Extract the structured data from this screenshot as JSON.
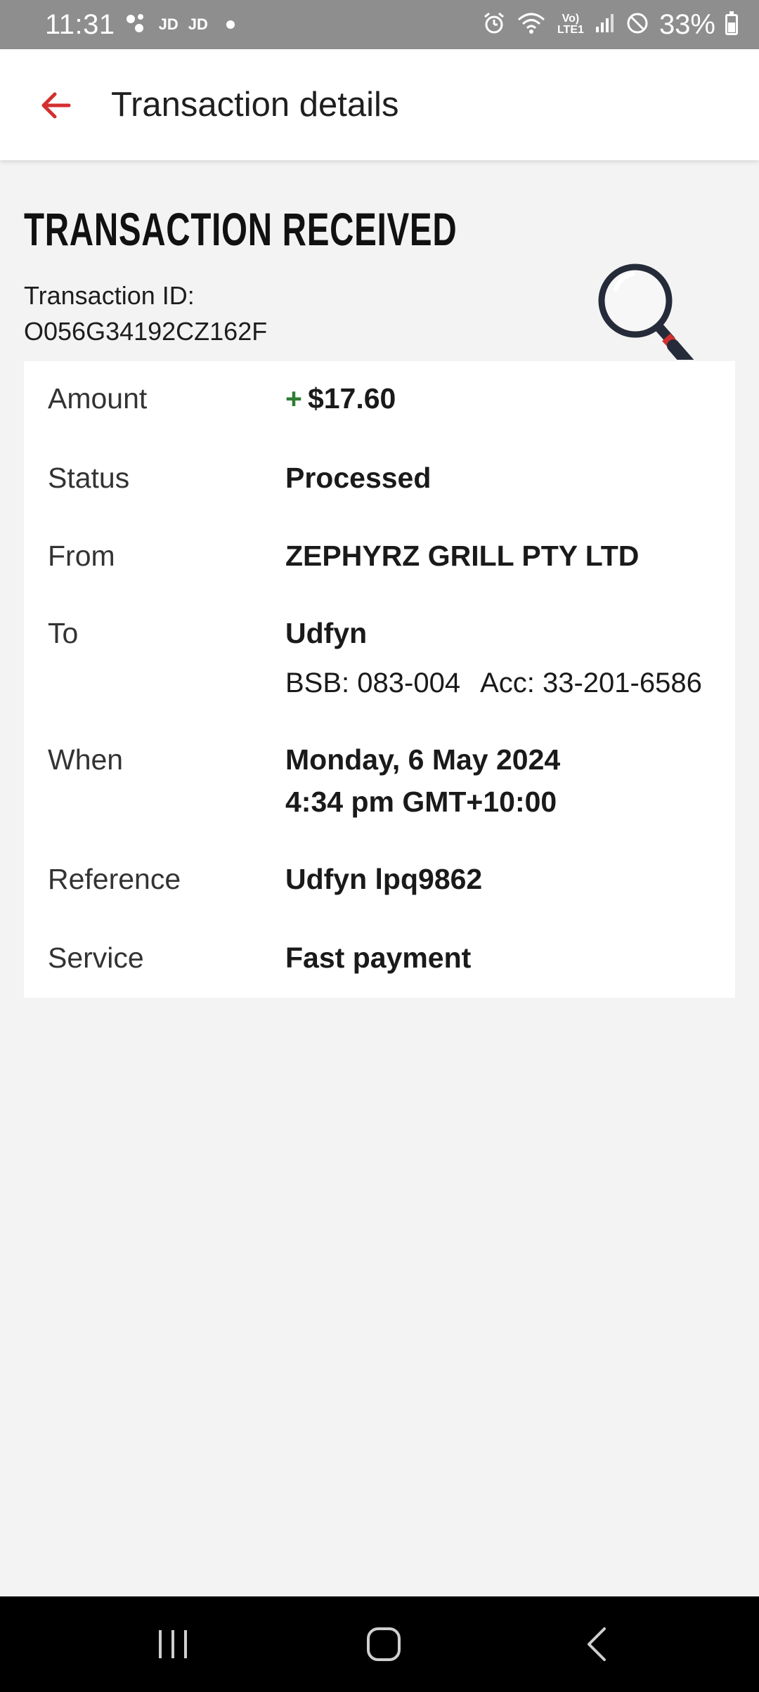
{
  "status_bar": {
    "time": "11:31",
    "notif_1": "JD",
    "notif_2": "JD",
    "network": "Vo) LTE1",
    "battery": "33%"
  },
  "app_bar": {
    "title": "Transaction details",
    "back_icon": "arrow-left-icon",
    "accent_color": "#d32f2f"
  },
  "transaction": {
    "heading": "TRANSACTION RECEIVED",
    "id_label": "Transaction ID:",
    "id_value": "O056G34192CZ162F",
    "illustration_icon": "magnifying-glass-icon"
  },
  "details": {
    "amount": {
      "label": "Amount",
      "sign": "+",
      "value": "$17.60",
      "sign_color": "#2e7d32"
    },
    "status": {
      "label": "Status",
      "value": "Processed"
    },
    "from": {
      "label": "From",
      "value": "ZEPHYRZ GRILL PTY LTD"
    },
    "to": {
      "label": "To",
      "name": "Udfyn",
      "bsb": "BSB: 083-004",
      "acc": "Acc: 33-201-6586"
    },
    "when": {
      "label": "When",
      "date": "Monday, 6 May 2024",
      "time": "4:34 pm GMT+10:00"
    },
    "reference": {
      "label": "Reference",
      "value": "Udfyn lpq9862"
    },
    "service": {
      "label": "Service",
      "value": "Fast payment"
    }
  },
  "nav_bar": {
    "recents_icon": "recents-icon",
    "home_icon": "home-icon",
    "back_icon": "back-chevron-icon"
  }
}
